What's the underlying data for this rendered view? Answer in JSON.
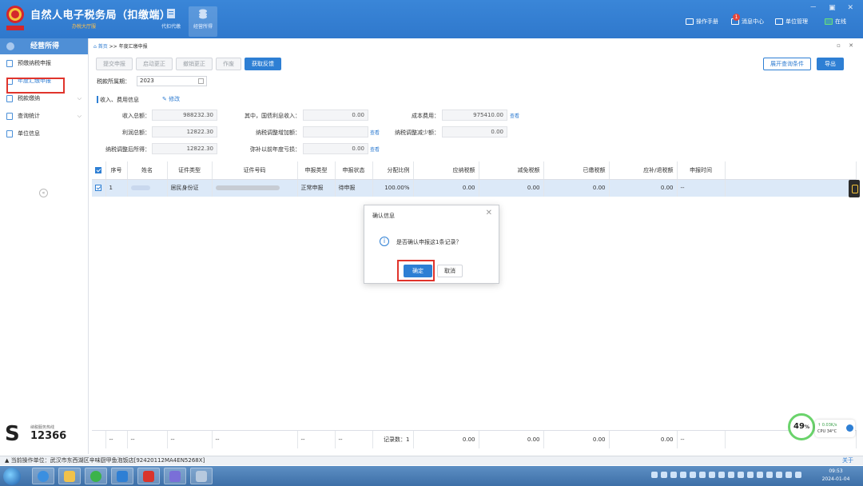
{
  "header": {
    "app_title": "自然人电子税务局（扣缴端）",
    "app_subtitle": "办税大厅服",
    "modules": [
      {
        "label": "代扣代缴"
      },
      {
        "label": "经营所得"
      }
    ],
    "right_items": [
      {
        "label": "操作手册"
      },
      {
        "label": "消息中心",
        "badge": "1"
      },
      {
        "label": "单位管理"
      },
      {
        "label": "在线"
      }
    ],
    "window_controls": "－ ▣ ✕"
  },
  "sidebar": {
    "section_title": "经营所得",
    "items": [
      {
        "label": "预缴纳税申报"
      },
      {
        "label": "年度汇缴申报",
        "active": true
      },
      {
        "label": "税款缴纳",
        "chevron": "⌵"
      },
      {
        "label": "查询统计",
        "chevron": "⌵"
      },
      {
        "label": "单位信息"
      }
    ],
    "collapse_symbol": "«",
    "hotline_label": "纳税服务热线",
    "hotline_number": "12366"
  },
  "breadcrumb": {
    "home": "首页",
    "sep": ">>",
    "current": "年度汇缴申报"
  },
  "tab_controls": "▫ ✕",
  "toolbar": {
    "buttons": [
      "提交申报",
      "启动更正",
      "撤销更正",
      "作废",
      "获取反馈"
    ],
    "expand": "展开查询条件",
    "export": "导出"
  },
  "period": {
    "label": "税款所属期：",
    "value": "2023"
  },
  "section": {
    "title": "收入、费用信息",
    "edit": "修改"
  },
  "fields": {
    "income_total_label": "收入总额：",
    "income_total": "988232.30",
    "bond_interest_label": "其中，国债利息收入：",
    "bond_interest": "0.00",
    "cost_label": "成本费用：",
    "cost": "975410.00",
    "cost_view": "查看",
    "profit_label": "利润总额：",
    "profit": "12822.30",
    "adj_inc_label": "纳税调整增加额：",
    "adj_inc": "",
    "adj_inc_view": "查看",
    "adj_dec_label": "纳税调整减少额：",
    "adj_dec": "0.00",
    "adj_profit_label": "纳税调整后所得：",
    "adj_profit": "12822.30",
    "loss_label": "弥补以前年度亏损：",
    "loss": "0.00",
    "loss_view": "查看"
  },
  "table": {
    "columns": [
      "序号",
      "姓名",
      "证件类型",
      "证件号码",
      "申报类型",
      "申报状态",
      "分配比例",
      "应纳税额",
      "减免税额",
      "已缴税额",
      "应补/退税额",
      "申报时间"
    ],
    "rows": [
      {
        "index": "1",
        "name": "",
        "id_type": "居民身份证",
        "id_number": "",
        "decl_type": "正常申报",
        "decl_status": "待申报",
        "ratio": "100.00%",
        "tax_due": "0.00",
        "tax_relief": "0.00",
        "tax_paid": "0.00",
        "tax_balance": "0.00",
        "decl_time": "--"
      }
    ],
    "footer": {
      "c1": "--",
      "c2": "--",
      "c3": "--",
      "c4": "--",
      "c5": "--",
      "c6": "--",
      "count": "记录数：1",
      "tax_due": "0.00",
      "tax_relief": "0.00",
      "tax_paid": "0.00",
      "tax_balance": "0.00",
      "decl_time": "--"
    }
  },
  "modal": {
    "title": "确认信息",
    "close": "✕",
    "icon": "i",
    "message": "是否确认申报这1条记录？",
    "ok": "确定",
    "cancel": "取消"
  },
  "status_bar": {
    "text": "当前操作单位：武汉市东西湖区辛味厨甲鱼泡饭店[92420112MA4EN5268X]",
    "about": "关于"
  },
  "perf_widget": {
    "percent": "49",
    "percent_sign": "%",
    "net_speed": "↑ 0.03K/s",
    "cpu": "CPU 34°C"
  },
  "clock": {
    "time": "09:53",
    "date": "2024-01-04"
  },
  "colors": {
    "brand_blue": "#2e7fd4",
    "highlight_red": "#e0342c",
    "selected_row": "#dce9f8"
  }
}
